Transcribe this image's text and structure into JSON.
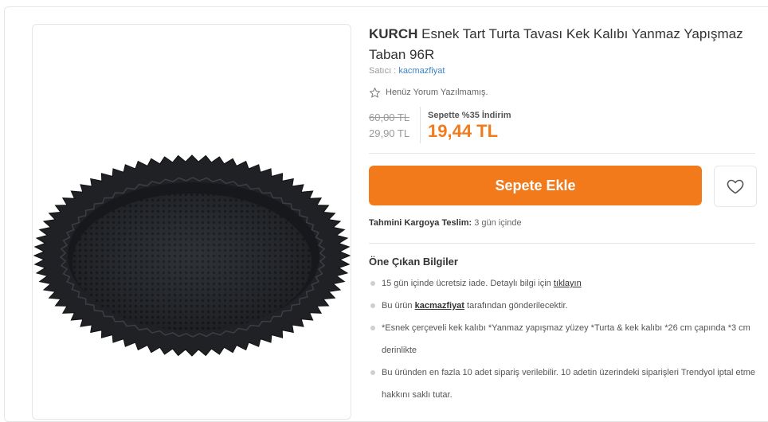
{
  "product": {
    "brand": "KURCH",
    "name": "Esnek Tart Turta Tavası Kek Kalıbı Yanmaz Yapışmaz Taban 96R",
    "seller_label": "Satıcı :",
    "seller_name": "kacmazfiyat",
    "review_text": "Henüz Yorum Yazılmamış."
  },
  "price": {
    "old": "60,00 TL",
    "list": "29,90 TL",
    "basket_label": "Sepette %35 İndirim",
    "basket_price": "19,44 TL"
  },
  "actions": {
    "add_to_cart": "Sepete Ekle"
  },
  "delivery": {
    "label": "Tahmini Kargoya Teslim:",
    "value": "3 gün içinde"
  },
  "features": {
    "title": "Öne Çıkan Bilgiler",
    "item1_text": "15 gün içinde ücretsiz iade. Detaylı bilgi için",
    "item1_link": "tıklayın",
    "item2_prefix": "Bu ürün",
    "item2_link": "kacmazfiyat",
    "item2_suffix": "tarafından gönderilecektir.",
    "item3": "*Esnek çerçeveli kek kalıbı *Yanmaz yapışmaz yüzey *Turta & kek kalıbı *26 cm çapında *3 cm derinlikte",
    "item4": "Bu üründen en fazla 10 adet sipariş verilebilir. 10 adetin üzerindeki siparişleri Trendyol iptal etme hakkını saklı tutar."
  },
  "colors": {
    "accent": "#f27a1a",
    "link": "#3d82c4"
  },
  "icons": {
    "review": "star-outline-icon",
    "favorite": "heart-outline-icon"
  }
}
